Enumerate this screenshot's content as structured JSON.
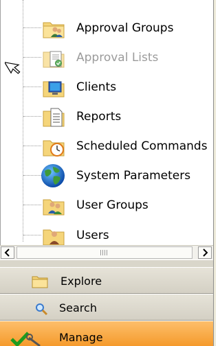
{
  "tree": {
    "items": [
      {
        "label": "Approval Groups",
        "icon": "group-folder-icon",
        "disabled": false
      },
      {
        "label": "Approval Lists",
        "icon": "list-folder-icon",
        "disabled": true
      },
      {
        "label": "Clients",
        "icon": "monitor-folder-icon",
        "disabled": false
      },
      {
        "label": "Reports",
        "icon": "report-folder-icon",
        "disabled": false
      },
      {
        "label": "Scheduled Commands",
        "icon": "clock-folder-icon",
        "disabled": false
      },
      {
        "label": "System Parameters",
        "icon": "globe-icon",
        "disabled": false
      },
      {
        "label": "User Groups",
        "icon": "users-folder-icon",
        "disabled": false
      },
      {
        "label": "Users",
        "icon": "user-folder-icon",
        "disabled": false
      }
    ]
  },
  "nav": {
    "explore_label": "Explore",
    "search_label": "Search",
    "manage_label": "Manage"
  },
  "colors": {
    "folder": "#f5d57a",
    "manage_active": "#f8a53c",
    "disabled_text": "#9b9b9b"
  }
}
